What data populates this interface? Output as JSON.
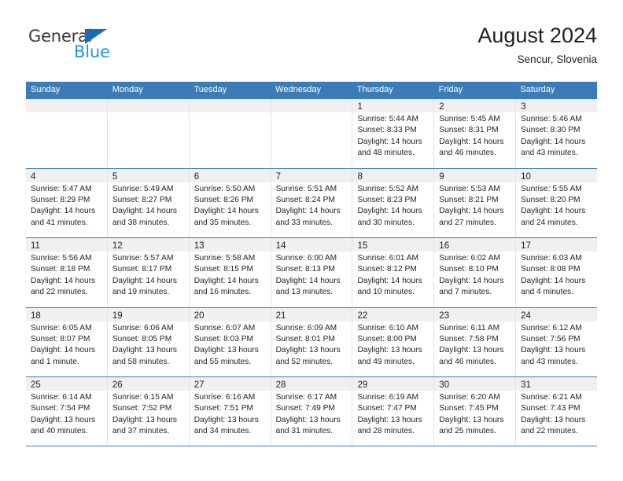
{
  "logo": {
    "word_one": "General",
    "word_two": "Blue",
    "triangle_color": "#1b6cb5",
    "blue_color": "#2196e8"
  },
  "header": {
    "title": "August 2024",
    "subtitle": "Sencur, Slovenia"
  },
  "theme": {
    "header_blue": "#3b7cb8",
    "band_gray": "#f0f0f0",
    "text": "#231f20"
  },
  "weekdays": [
    "Sunday",
    "Monday",
    "Tuesday",
    "Wednesday",
    "Thursday",
    "Friday",
    "Saturday"
  ],
  "weeks": [
    [
      {
        "day": "",
        "empty": true
      },
      {
        "day": "",
        "empty": true
      },
      {
        "day": "",
        "empty": true
      },
      {
        "day": "",
        "empty": true
      },
      {
        "day": "1",
        "sunrise": "Sunrise: 5:44 AM",
        "sunset": "Sunset: 8:33 PM",
        "daylight1": "Daylight: 14 hours",
        "daylight2": "and 48 minutes."
      },
      {
        "day": "2",
        "sunrise": "Sunrise: 5:45 AM",
        "sunset": "Sunset: 8:31 PM",
        "daylight1": "Daylight: 14 hours",
        "daylight2": "and 46 minutes."
      },
      {
        "day": "3",
        "sunrise": "Sunrise: 5:46 AM",
        "sunset": "Sunset: 8:30 PM",
        "daylight1": "Daylight: 14 hours",
        "daylight2": "and 43 minutes."
      }
    ],
    [
      {
        "day": "4",
        "sunrise": "Sunrise: 5:47 AM",
        "sunset": "Sunset: 8:29 PM",
        "daylight1": "Daylight: 14 hours",
        "daylight2": "and 41 minutes."
      },
      {
        "day": "5",
        "sunrise": "Sunrise: 5:49 AM",
        "sunset": "Sunset: 8:27 PM",
        "daylight1": "Daylight: 14 hours",
        "daylight2": "and 38 minutes."
      },
      {
        "day": "6",
        "sunrise": "Sunrise: 5:50 AM",
        "sunset": "Sunset: 8:26 PM",
        "daylight1": "Daylight: 14 hours",
        "daylight2": "and 35 minutes."
      },
      {
        "day": "7",
        "sunrise": "Sunrise: 5:51 AM",
        "sunset": "Sunset: 8:24 PM",
        "daylight1": "Daylight: 14 hours",
        "daylight2": "and 33 minutes."
      },
      {
        "day": "8",
        "sunrise": "Sunrise: 5:52 AM",
        "sunset": "Sunset: 8:23 PM",
        "daylight1": "Daylight: 14 hours",
        "daylight2": "and 30 minutes."
      },
      {
        "day": "9",
        "sunrise": "Sunrise: 5:53 AM",
        "sunset": "Sunset: 8:21 PM",
        "daylight1": "Daylight: 14 hours",
        "daylight2": "and 27 minutes."
      },
      {
        "day": "10",
        "sunrise": "Sunrise: 5:55 AM",
        "sunset": "Sunset: 8:20 PM",
        "daylight1": "Daylight: 14 hours",
        "daylight2": "and 24 minutes."
      }
    ],
    [
      {
        "day": "11",
        "sunrise": "Sunrise: 5:56 AM",
        "sunset": "Sunset: 8:18 PM",
        "daylight1": "Daylight: 14 hours",
        "daylight2": "and 22 minutes."
      },
      {
        "day": "12",
        "sunrise": "Sunrise: 5:57 AM",
        "sunset": "Sunset: 8:17 PM",
        "daylight1": "Daylight: 14 hours",
        "daylight2": "and 19 minutes."
      },
      {
        "day": "13",
        "sunrise": "Sunrise: 5:58 AM",
        "sunset": "Sunset: 8:15 PM",
        "daylight1": "Daylight: 14 hours",
        "daylight2": "and 16 minutes."
      },
      {
        "day": "14",
        "sunrise": "Sunrise: 6:00 AM",
        "sunset": "Sunset: 8:13 PM",
        "daylight1": "Daylight: 14 hours",
        "daylight2": "and 13 minutes."
      },
      {
        "day": "15",
        "sunrise": "Sunrise: 6:01 AM",
        "sunset": "Sunset: 8:12 PM",
        "daylight1": "Daylight: 14 hours",
        "daylight2": "and 10 minutes."
      },
      {
        "day": "16",
        "sunrise": "Sunrise: 6:02 AM",
        "sunset": "Sunset: 8:10 PM",
        "daylight1": "Daylight: 14 hours",
        "daylight2": "and 7 minutes."
      },
      {
        "day": "17",
        "sunrise": "Sunrise: 6:03 AM",
        "sunset": "Sunset: 8:08 PM",
        "daylight1": "Daylight: 14 hours",
        "daylight2": "and 4 minutes."
      }
    ],
    [
      {
        "day": "18",
        "sunrise": "Sunrise: 6:05 AM",
        "sunset": "Sunset: 8:07 PM",
        "daylight1": "Daylight: 14 hours",
        "daylight2": "and 1 minute."
      },
      {
        "day": "19",
        "sunrise": "Sunrise: 6:06 AM",
        "sunset": "Sunset: 8:05 PM",
        "daylight1": "Daylight: 13 hours",
        "daylight2": "and 58 minutes."
      },
      {
        "day": "20",
        "sunrise": "Sunrise: 6:07 AM",
        "sunset": "Sunset: 8:03 PM",
        "daylight1": "Daylight: 13 hours",
        "daylight2": "and 55 minutes."
      },
      {
        "day": "21",
        "sunrise": "Sunrise: 6:09 AM",
        "sunset": "Sunset: 8:01 PM",
        "daylight1": "Daylight: 13 hours",
        "daylight2": "and 52 minutes."
      },
      {
        "day": "22",
        "sunrise": "Sunrise: 6:10 AM",
        "sunset": "Sunset: 8:00 PM",
        "daylight1": "Daylight: 13 hours",
        "daylight2": "and 49 minutes."
      },
      {
        "day": "23",
        "sunrise": "Sunrise: 6:11 AM",
        "sunset": "Sunset: 7:58 PM",
        "daylight1": "Daylight: 13 hours",
        "daylight2": "and 46 minutes."
      },
      {
        "day": "24",
        "sunrise": "Sunrise: 6:12 AM",
        "sunset": "Sunset: 7:56 PM",
        "daylight1": "Daylight: 13 hours",
        "daylight2": "and 43 minutes."
      }
    ],
    [
      {
        "day": "25",
        "sunrise": "Sunrise: 6:14 AM",
        "sunset": "Sunset: 7:54 PM",
        "daylight1": "Daylight: 13 hours",
        "daylight2": "and 40 minutes."
      },
      {
        "day": "26",
        "sunrise": "Sunrise: 6:15 AM",
        "sunset": "Sunset: 7:52 PM",
        "daylight1": "Daylight: 13 hours",
        "daylight2": "and 37 minutes."
      },
      {
        "day": "27",
        "sunrise": "Sunrise: 6:16 AM",
        "sunset": "Sunset: 7:51 PM",
        "daylight1": "Daylight: 13 hours",
        "daylight2": "and 34 minutes."
      },
      {
        "day": "28",
        "sunrise": "Sunrise: 6:17 AM",
        "sunset": "Sunset: 7:49 PM",
        "daylight1": "Daylight: 13 hours",
        "daylight2": "and 31 minutes."
      },
      {
        "day": "29",
        "sunrise": "Sunrise: 6:19 AM",
        "sunset": "Sunset: 7:47 PM",
        "daylight1": "Daylight: 13 hours",
        "daylight2": "and 28 minutes."
      },
      {
        "day": "30",
        "sunrise": "Sunrise: 6:20 AM",
        "sunset": "Sunset: 7:45 PM",
        "daylight1": "Daylight: 13 hours",
        "daylight2": "and 25 minutes."
      },
      {
        "day": "31",
        "sunrise": "Sunrise: 6:21 AM",
        "sunset": "Sunset: 7:43 PM",
        "daylight1": "Daylight: 13 hours",
        "daylight2": "and 22 minutes."
      }
    ]
  ]
}
